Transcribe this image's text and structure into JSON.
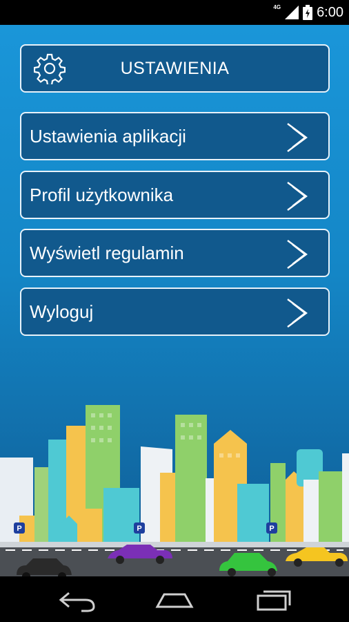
{
  "status_bar": {
    "time": "6:00",
    "network": "4G"
  },
  "header": {
    "title": "USTAWIENIA"
  },
  "menu": [
    {
      "label": "Ustawienia aplikacji"
    },
    {
      "label": "Profil użytkownika"
    },
    {
      "label": "Wyświetl regulamin"
    },
    {
      "label": "Wyloguj"
    }
  ],
  "colors": {
    "background_top": "#1a96d9",
    "button_fill": "#11598d",
    "button_border": "#e8f2fa",
    "parking_sign": "#1e3f9e"
  },
  "parking_signs": [
    "P",
    "P",
    "P"
  ]
}
